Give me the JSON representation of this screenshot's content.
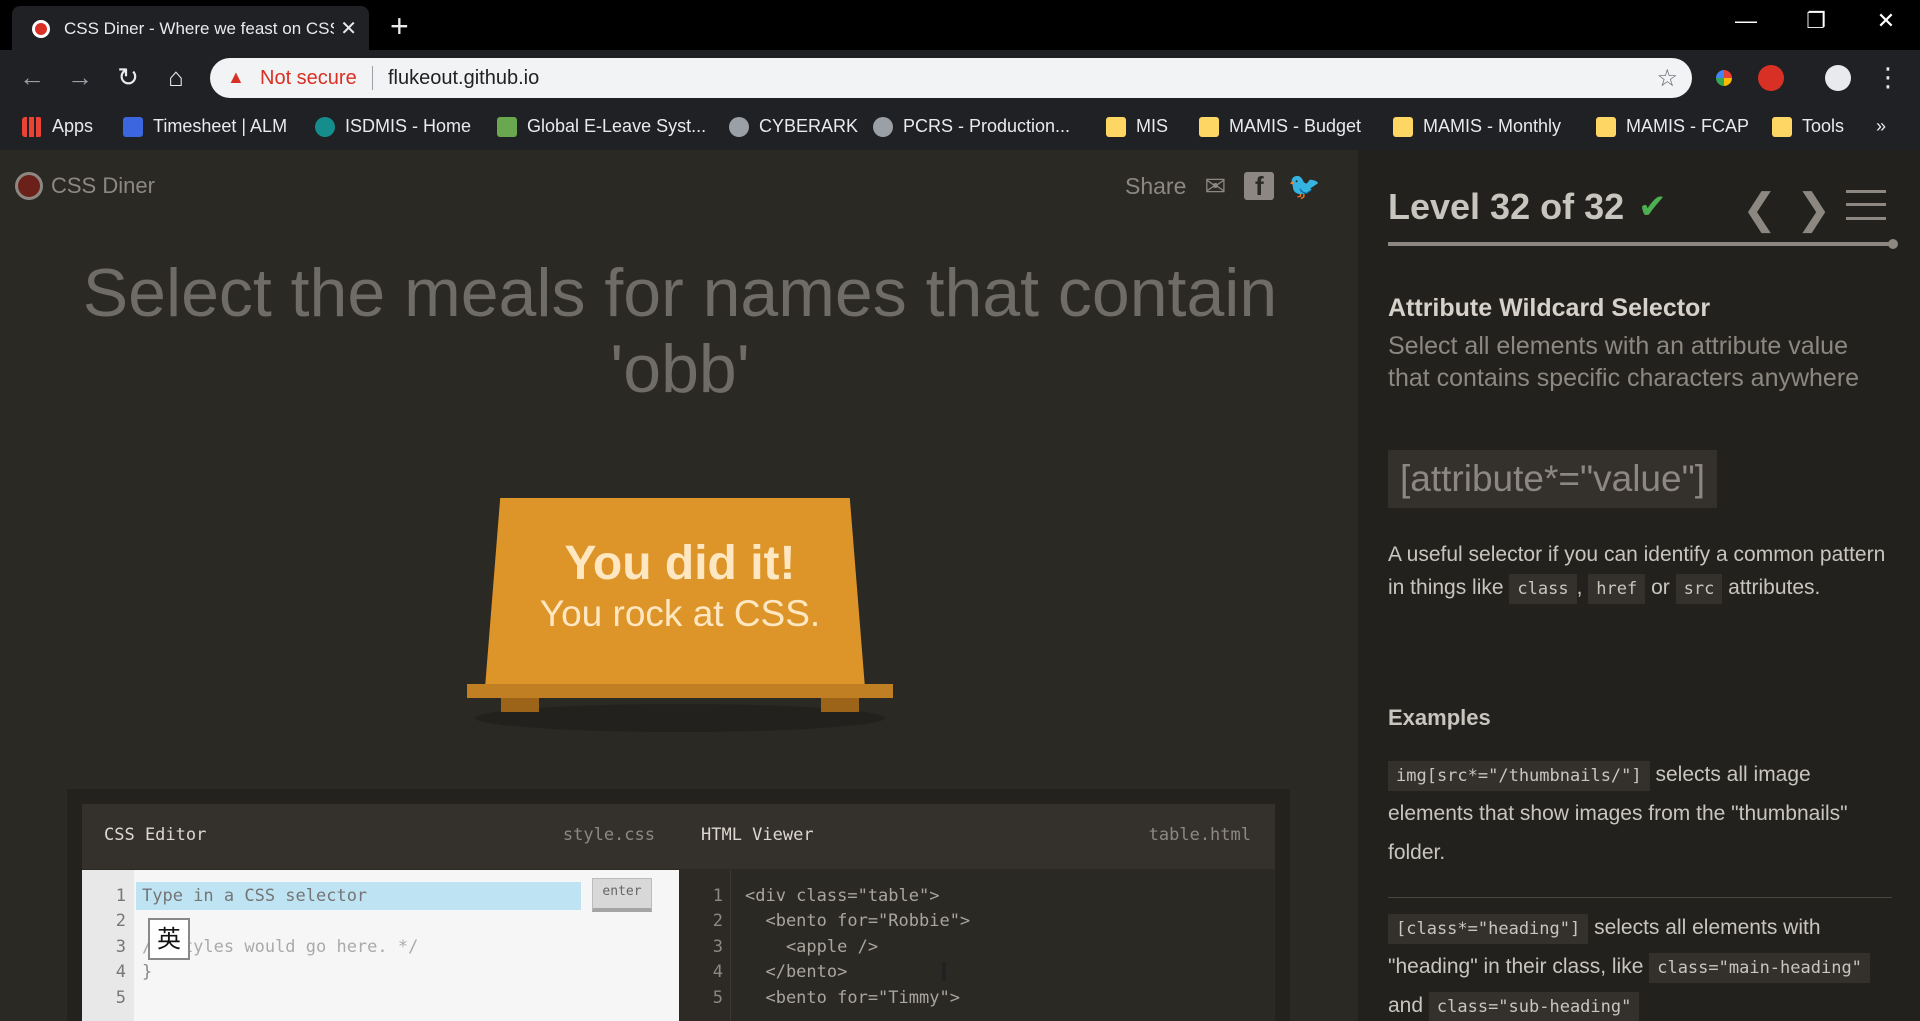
{
  "browser": {
    "tab_title": "CSS Diner - Where we feast on CSS",
    "tab_close": "✕",
    "new_tab": "+",
    "window_controls": [
      "—",
      "❐",
      "✕"
    ],
    "not_secure": "Not secure",
    "url": "flukeout.github.io",
    "bookmarks": [
      {
        "label": "Apps",
        "icon": "apps-grid-icon"
      },
      {
        "label": "Timesheet | ALM",
        "icon": "alm-icon"
      },
      {
        "label": "ISDMIS - Home",
        "icon": "sharepoint-icon"
      },
      {
        "label": "Global E-Leave Syst...",
        "icon": "calendar-icon"
      },
      {
        "label": "CYBERARK",
        "icon": "globe-icon"
      },
      {
        "label": "PCRS - Production...",
        "icon": "globe-icon"
      },
      {
        "label": "MIS",
        "icon": "folder-icon"
      },
      {
        "label": "MAMIS - Budget",
        "icon": "folder-icon"
      },
      {
        "label": "MAMIS - Monthly",
        "icon": "folder-icon"
      },
      {
        "label": "MAMIS - FCAP",
        "icon": "folder-icon"
      },
      {
        "label": "Tools",
        "icon": "folder-icon"
      }
    ],
    "bookmarks_overflow": "»"
  },
  "game": {
    "logo_text": "CSS Diner",
    "share_label": "Share",
    "instruction": "Select the meals for names that contain 'obb'",
    "success_line1": "You did it!",
    "success_line2": "You rock at CSS.",
    "css_editor": {
      "title": "CSS Editor",
      "file": "style.css",
      "line_numbers": [
        "1",
        "2",
        "3",
        "4",
        "5"
      ],
      "placeholder": "Type in a CSS selector",
      "enter_label": "enter",
      "line3": "/* Styles would go here. */",
      "line4": "}",
      "ime_char": "英"
    },
    "html_viewer": {
      "title": "HTML Viewer",
      "file": "table.html",
      "line_numbers": [
        "1",
        "2",
        "3",
        "4",
        "5"
      ],
      "lines": [
        "<div class=\"table\">",
        "  <bento for=\"Robbie\">",
        "    <apple />",
        "  </bento>",
        "  <bento for=\"Timmy\">"
      ]
    }
  },
  "sidebar": {
    "level": "Level 32 of 32",
    "check": "✔",
    "prev": "❮",
    "next": "❯",
    "selector_name": "Attribute Wildcard Selector",
    "selector_title": "Select all elements with an attribute value that contains specific characters anywhere",
    "syntax": "[attribute*=\"value\"]",
    "hint_pre": "A useful selector if you can identify a common pattern in things like",
    "hint_code1": "class",
    "hint_comma": ",",
    "hint_code2": "href",
    "hint_or": "or",
    "hint_code3": "src",
    "hint_post": "attributes.",
    "examples_title": "Examples",
    "example1_code": "img[src*=\"/thumbnails/\"]",
    "example1_text": "selects all image elements that show images from the \"thumbnails\" folder.",
    "example2_code": "[class*=\"heading\"]",
    "example2_text_a": "selects all elements with \"heading\" in their class, like",
    "example2_code2": "class=\"main-heading\"",
    "example2_and": "and",
    "example2_code3": "class=\"sub-heading\""
  },
  "colors": {
    "accent_table": "#dd9428",
    "check_green": "#4caf50",
    "not_secure_red": "#d93025"
  }
}
